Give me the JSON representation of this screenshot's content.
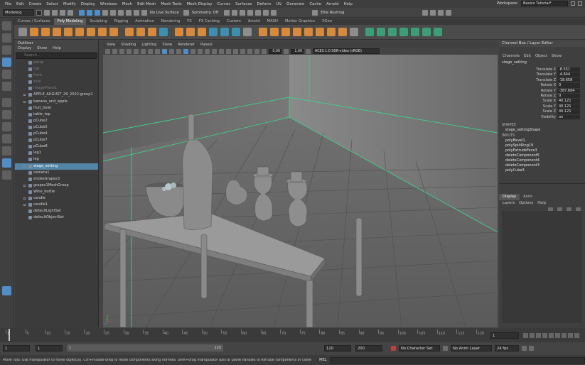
{
  "menubar": {
    "items": [
      "File",
      "Edit",
      "Create",
      "Select",
      "Modify",
      "Display",
      "Windows",
      "Mesh",
      "Edit Mesh",
      "Mesh Tools",
      "Mesh Display",
      "Curves",
      "Surfaces",
      "Deform",
      "UV",
      "Generate",
      "Cache",
      "Arnold",
      "Help"
    ],
    "workspace_label": "Workspace:",
    "workspace_value": "Basics Tutorial*"
  },
  "statusline": {
    "mode": "Modeling",
    "live_surface": "No Live Surface",
    "symmetry": "Symmetry: Off",
    "user": "Ellie Rushing"
  },
  "shelf": {
    "tabs": [
      "Curves / Surfaces",
      "Poly Modeling",
      "Sculpting",
      "Rigging",
      "Animation",
      "Rendering",
      "FX",
      "FX Caching",
      "Custom",
      "Arnold",
      "MASH",
      "Motion Graphics",
      "XGen"
    ],
    "active_tab": "Poly Modeling"
  },
  "outliner": {
    "title": "Outliner",
    "menu": [
      "Display",
      "Show",
      "Help"
    ],
    "search_placeholder": "Search...",
    "items": [
      {
        "label": "persp",
        "dim": true,
        "expand": false
      },
      {
        "label": "top",
        "dim": true,
        "expand": false
      },
      {
        "label": "front",
        "dim": true,
        "expand": false
      },
      {
        "label": "side",
        "dim": true,
        "expand": false
      },
      {
        "label": "ImagePlane1",
        "dim": true,
        "expand": false
      },
      {
        "label": "APPLE_AUGUST_29_2022:group1",
        "dim": false,
        "expand": true
      },
      {
        "label": "banana_and_apple",
        "dim": false,
        "expand": true
      },
      {
        "label": "fruit_bowl",
        "dim": false,
        "expand": false
      },
      {
        "label": "table_top",
        "dim": false,
        "expand": false
      },
      {
        "label": "pCube2",
        "dim": false,
        "expand": false
      },
      {
        "label": "pCube5",
        "dim": false,
        "expand": false
      },
      {
        "label": "pCube4",
        "dim": false,
        "expand": false
      },
      {
        "label": "pCube7",
        "dim": false,
        "expand": false
      },
      {
        "label": "pCube8",
        "dim": false,
        "expand": false
      },
      {
        "label": "leg1",
        "dim": false,
        "expand": false
      },
      {
        "label": "leg",
        "dim": false,
        "expand": false
      },
      {
        "label": "stage_setting",
        "dim": false,
        "expand": true,
        "selected": true
      },
      {
        "label": "camera1",
        "dim": false,
        "expand": false
      },
      {
        "label": "strokeGrapes3",
        "dim": false,
        "expand": false
      },
      {
        "label": "grapes1MeshGroup",
        "dim": false,
        "expand": true
      },
      {
        "label": "Wine_bottle",
        "dim": false,
        "expand": false
      },
      {
        "label": "candle",
        "dim": false,
        "expand": true
      },
      {
        "label": "candle1",
        "dim": false,
        "expand": true
      },
      {
        "label": "defaultLightSet",
        "dim": false,
        "expand": false
      },
      {
        "label": "defaultObjectSet",
        "dim": false,
        "expand": false
      }
    ]
  },
  "viewport": {
    "menu": [
      "View",
      "Shading",
      "Lighting",
      "Show",
      "Renderer",
      "Panels"
    ],
    "field_a": "0.00",
    "field_b": "1.00",
    "colorspace": "ACES 1.0 SDR-video (sRGB)"
  },
  "channelbox": {
    "title": "Channel Box / Layer Editor",
    "menu": [
      "Channels",
      "Edit",
      "Object",
      "Show"
    ],
    "object_name": "stage_setting",
    "attributes": [
      {
        "label": "Translate X",
        "value": "-8.551"
      },
      {
        "label": "Translate Y",
        "value": "-4.644"
      },
      {
        "label": "Translate Z",
        "value": "-18.658"
      },
      {
        "label": "Rotate X",
        "value": "0"
      },
      {
        "label": "Rotate Y",
        "value": "-387.684"
      },
      {
        "label": "Rotate Z",
        "value": "0"
      },
      {
        "label": "Scale X",
        "value": "40.121"
      },
      {
        "label": "Scale Y",
        "value": "40.121"
      },
      {
        "label": "Scale Z",
        "value": "40.121"
      },
      {
        "label": "Visibility",
        "value": "on"
      }
    ],
    "shapes_label": "SHAPES",
    "shapes": [
      "stage_settingShape"
    ],
    "inputs_label": "INPUTS",
    "inputs": [
      "polyBevel1",
      "polySplitRing19",
      "polyExtrudeFace3",
      "deleteComponent5",
      "deleteComponent4",
      "deleteComponent3",
      "polyCube3"
    ],
    "layer_tabs": [
      "Display",
      "Anim"
    ],
    "layer_menu": [
      "Layers",
      "Options",
      "Help"
    ]
  },
  "timeline": {
    "ticks": [
      "1",
      "5",
      "10",
      "15",
      "20",
      "25",
      "30",
      "35",
      "40",
      "45",
      "50",
      "55",
      "60",
      "65",
      "70",
      "75",
      "80",
      "85",
      "90",
      "95",
      "100",
      "105",
      "110",
      "115",
      "120"
    ],
    "current_frame": "1"
  },
  "range": {
    "start": "1",
    "start_inner": "1",
    "slider_start": "1",
    "slider_end": "120",
    "end_inner": "120",
    "end": "200",
    "character_set": "No Character Set",
    "anim_layer": "No Anim Layer",
    "fps": "24 fps"
  },
  "helpline": {
    "message": "Move Tool: Use manipulator to move object(s). Ctrl+middle-drag to move components along normals. Shift+drag manipulator axis or plane handles to extrude components or clone objects",
    "mel_label": "MEL"
  }
}
